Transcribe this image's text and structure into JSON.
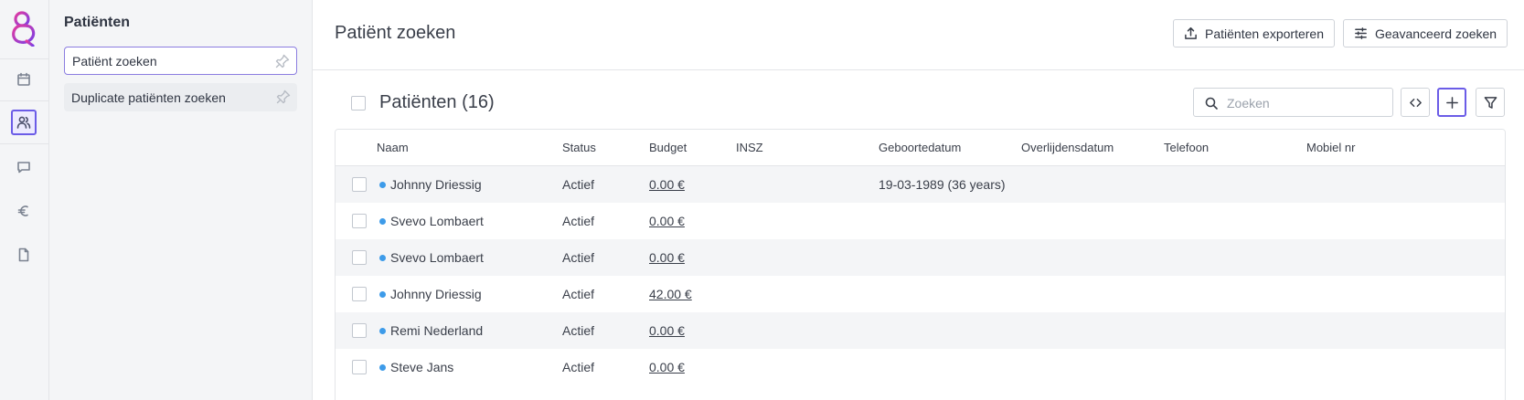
{
  "colors": {
    "accent": "#6b5ce7",
    "status_dot": "#3d9be9",
    "logo_pink": "#e23aa0",
    "logo_purple": "#7b3fe4"
  },
  "rail": {
    "items": [
      {
        "name": "calendar-icon"
      },
      {
        "name": "users-icon",
        "active": true
      },
      {
        "name": "message-icon"
      },
      {
        "name": "euro-icon"
      },
      {
        "name": "document-icon"
      }
    ]
  },
  "subnav": {
    "title": "Patiënten",
    "items": [
      {
        "label": "Patiënt zoeken",
        "active": true
      },
      {
        "label": "Duplicate patiënten zoeken"
      }
    ]
  },
  "header": {
    "title": "Patiënt zoeken",
    "export_label": "Patiënten exporteren",
    "advanced_label": "Geavanceerd zoeken"
  },
  "list": {
    "title": "Patiënten (16)",
    "search_placeholder": "Zoeken"
  },
  "table": {
    "columns": [
      "Naam",
      "Status",
      "Budget",
      "INSZ",
      "Geboortedatum",
      "Overlijdensdatum",
      "Telefoon",
      "Mobiel nr"
    ],
    "rows": [
      {
        "naam": "Johnny Driessig",
        "status": "Actief",
        "budget": "0.00 €",
        "insz": "",
        "geboortedatum": "19-03-1989 (36 years)",
        "overlijdensdatum": "",
        "telefoon": "",
        "mobiel": ""
      },
      {
        "naam": "Svevo Lombaert",
        "status": "Actief",
        "budget": "0.00 €",
        "insz": "",
        "geboortedatum": "",
        "overlijdensdatum": "",
        "telefoon": "",
        "mobiel": ""
      },
      {
        "naam": "Svevo Lombaert",
        "status": "Actief",
        "budget": "0.00 €",
        "insz": "",
        "geboortedatum": "",
        "overlijdensdatum": "",
        "telefoon": "",
        "mobiel": ""
      },
      {
        "naam": "Johnny Driessig",
        "status": "Actief",
        "budget": "42.00 €",
        "insz": "",
        "geboortedatum": "",
        "overlijdensdatum": "",
        "telefoon": "",
        "mobiel": ""
      },
      {
        "naam": "Remi Nederland",
        "status": "Actief",
        "budget": "0.00 €",
        "insz": "",
        "geboortedatum": "",
        "overlijdensdatum": "",
        "telefoon": "",
        "mobiel": ""
      },
      {
        "naam": "Steve Jans",
        "status": "Actief",
        "budget": "0.00 €",
        "insz": "",
        "geboortedatum": "",
        "overlijdensdatum": "",
        "telefoon": "",
        "mobiel": ""
      }
    ]
  }
}
